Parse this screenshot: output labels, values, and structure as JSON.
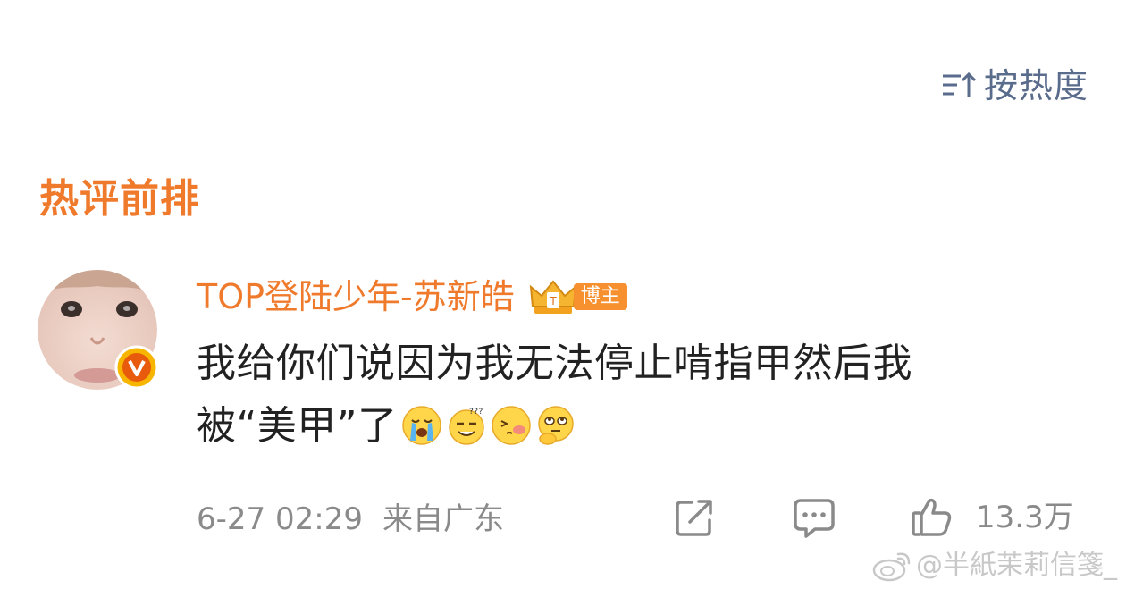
{
  "sort": {
    "icon": "sort-icon",
    "label": "按热度"
  },
  "section": {
    "title": "热评前排"
  },
  "comment": {
    "avatar_icon": "avatar",
    "verified_icon": "verified-v-icon",
    "username": "TOP登陆少年-苏新皓",
    "badge_icon": "crown-icon",
    "author_tag": "博主",
    "text_line1": "我给你们说因为我无法停止啃指甲然后我",
    "text_line2": "被“美甲”了",
    "emojis": [
      "crying-emoji",
      "confused-emoji",
      "shy-emoji",
      "thinking-emoji"
    ],
    "date": "6-27 02:29",
    "location": "来自广东",
    "like_count": "13.3万"
  },
  "actions": {
    "share_icon": "share-icon",
    "comment_icon": "comment-icon",
    "like_icon": "like-icon"
  },
  "watermark": {
    "icon": "weibo-icon",
    "text": "@半紙茉莉信箋_"
  },
  "colors": {
    "accent": "#f07a2c",
    "sort": "#5a6c8c",
    "text": "#222222",
    "meta": "#8a8a8a",
    "tag_bg": "#f7902f"
  }
}
